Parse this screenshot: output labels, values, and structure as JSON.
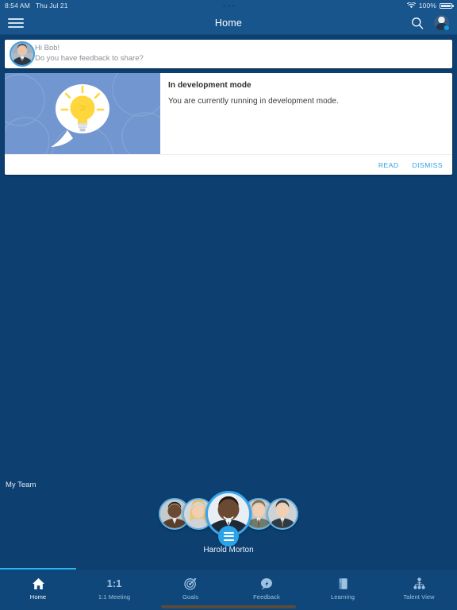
{
  "statusbar": {
    "time": "8:54 AM",
    "date": "Thu Jul 21",
    "battery_percent": "100%",
    "wifi_icon": "wifi-icon",
    "battery_icon": "battery-full-icon",
    "multitask_dots": "three-dots-indicator"
  },
  "navbar": {
    "menu_icon": "hamburger-menu-icon",
    "title": "Home",
    "search_icon": "search-icon",
    "profile_icon": "profile-avatar-icon"
  },
  "greeting": {
    "avatar": "user-avatar-photo",
    "line1": "Hi Bob!",
    "line2": "Do you have feedback to share?"
  },
  "notification": {
    "illustration": "lightbulb-speech-bubble-illustration",
    "title": "In development mode",
    "description": "You are currently running in development mode.",
    "read_label": "READ",
    "dismiss_label": "DISMISS"
  },
  "team": {
    "section_label": "My Team",
    "members": [
      {
        "name": "team-member-1",
        "selected": false
      },
      {
        "name": "team-member-2",
        "selected": false
      },
      {
        "name": "Harold Morton",
        "selected": true
      },
      {
        "name": "team-member-4",
        "selected": false
      },
      {
        "name": "team-member-5",
        "selected": false
      }
    ],
    "selected_name": "Harold Morton",
    "badge_icon": "list-menu-badge-icon"
  },
  "tabbar": {
    "items": [
      {
        "label": "Home",
        "icon": "home-icon",
        "active": true
      },
      {
        "label": "1:1 Meeting",
        "icon": "one-on-one-icon",
        "active": false
      },
      {
        "label": "Goals",
        "icon": "target-goal-icon",
        "active": false
      },
      {
        "label": "Feedback",
        "icon": "feedback-speech-icon",
        "active": false
      },
      {
        "label": "Learning",
        "icon": "book-learning-icon",
        "active": false
      },
      {
        "label": "Talent View",
        "icon": "org-chart-icon",
        "active": false
      }
    ],
    "one_one_glyph": "1:1"
  },
  "colors": {
    "background": "#0d4071",
    "navbar": "#17558c",
    "tabbar": "#10477a",
    "accent": "#29b6f6",
    "link": "#2f9fe0",
    "illustration_bg": "#7296cf",
    "bulb_yellow": "#ffd63b"
  }
}
